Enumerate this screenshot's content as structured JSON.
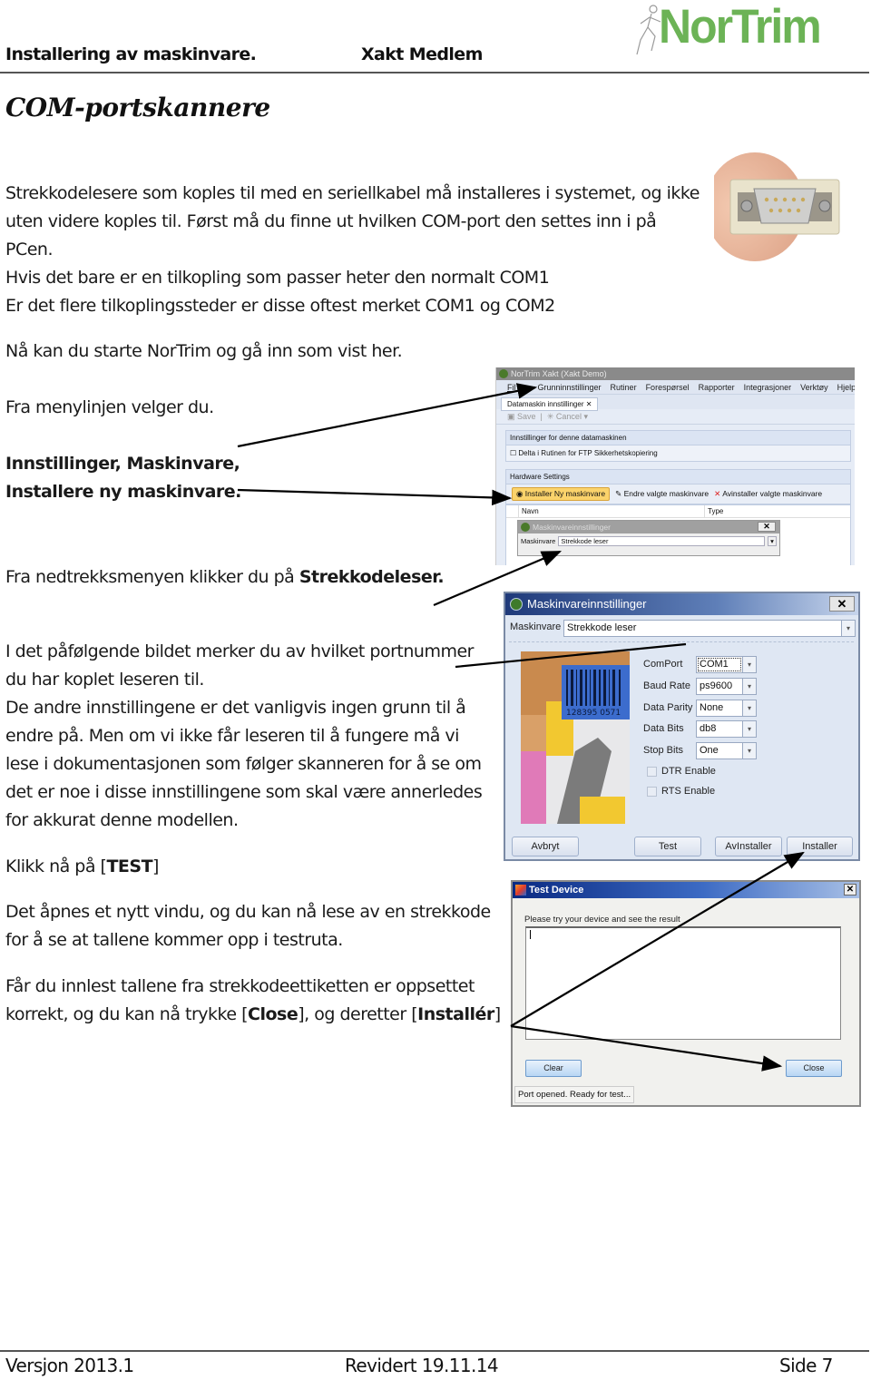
{
  "header": {
    "left_title": "Installering av maskinvare.",
    "center_title": "Xakt Medlem",
    "logo_text": "NorTrim"
  },
  "section_title": "COM-portskannere",
  "body": {
    "intro_lines": [
      "Strekkodelesere som koples til med en seriellkabel må installeres i systemet, og ikke",
      "uten videre koples til. Først må du finne ut hvilken COM-port den settes inn i på",
      "PCen.",
      "Hvis det bare er en tilkopling som passer heter den normalt COM1",
      "Er det flere tilkoplingssteder er disse oftest merket COM1 og COM2"
    ],
    "start_text": "Nå kan du starte NorTrim og gå inn som vist her.",
    "menu_text": "Fra menylinjen velger du.",
    "path_line1": "Innstillinger, Maskinvare,",
    "path_line2": "Installere ny maskinvare.",
    "dropdown_text_prefix": "Fra nedtrekksmenyen klikker du på ",
    "dropdown_text_bold": "Strekkodeleser.",
    "port_lines": [
      "I det påfølgende bildet merker du av hvilket portnummer",
      "du har koplet leseren til.",
      "De andre innstillingene er det vanligvis ingen grunn til å",
      "endre på. Men om vi ikke får leseren til å fungere må vi",
      "lese i dokumentasjonen som følger skanneren for å se om",
      "det er noe i disse innstillingene som skal være annerledes",
      "for akkurat denne modellen."
    ],
    "click_test_prefix": "Klikk nå på [",
    "click_test_bold": "TEST",
    "click_test_suffix": "]",
    "new_window_lines": [
      "Det åpnes et nytt vindu, og du kan nå lese av en strekkode",
      "for å se at tallene kommer opp i testruta."
    ],
    "final_line1": "Får du innlest tallene fra strekkodeettiketten er oppsettet",
    "final_line2_a": "korrekt, og du kan nå trykke [",
    "final_line2_close": "Close",
    "final_line2_b": "], og deretter [",
    "final_line2_install": "Installér",
    "final_line2_c": "]"
  },
  "screenshot_app": {
    "window_title": "NorTrim Xakt (Xakt Demo)",
    "menu": [
      "Fil",
      "Grunninnstillinger",
      "Rutiner",
      "Forespørsel",
      "Rapporter",
      "Integrasjoner",
      "Verktøy",
      "Hjelp"
    ],
    "tab": "Datamaskin innstillinger",
    "toolbar": [
      "Save",
      "Cancel"
    ],
    "group1_title": "Innstillinger for denne datamaskinen",
    "group1_checkbox": "Delta i Rutinen for FTP Sikkerhetskopiering",
    "group2_title": "Hardware Settings",
    "hw_buttons": [
      "Installer Ny maskinvare",
      "Endre valgte maskinvare",
      "Avinstaller valgte maskinvare"
    ],
    "grid_columns": [
      "Navn",
      "Type"
    ],
    "popup_title": "Maskinvareinnstillinger",
    "popup_label": "Maskinvare",
    "popup_value": "Strekkode leser"
  },
  "settings_dialog": {
    "title": "Maskinvareinnstillinger",
    "hardware_label": "Maskinvare",
    "hardware_value": "Strekkode leser",
    "fields": [
      {
        "label": "ComPort",
        "value": "COM1"
      },
      {
        "label": "Baud Rate",
        "value": "ps9600"
      },
      {
        "label": "Data Parity",
        "value": "None"
      },
      {
        "label": "Data Bits",
        "value": "db8"
      },
      {
        "label": "Stop Bits",
        "value": "One"
      }
    ],
    "checkboxes": [
      {
        "label": "DTR Enable",
        "checked": false
      },
      {
        "label": "RTS Enable",
        "checked": false
      }
    ],
    "buttons": {
      "cancel": "Avbryt",
      "test": "Test",
      "uninstall": "AvInstaller",
      "install": "Installer"
    },
    "barcode_number": "128395 0571"
  },
  "test_dialog": {
    "title": "Test Device",
    "prompt": "Please try your device and see the result",
    "result_value": "",
    "clear_label": "Clear",
    "close_label": "Close",
    "status": "Port opened. Ready for test..."
  },
  "footer": {
    "version": "Versjon 2013.1",
    "revised": "Revidert 19.11.14",
    "page": "Side 7"
  },
  "colors": {
    "logo_green": "#6cb356",
    "dialog_title_blue": "#1f3a7a",
    "highlight_button": "#fbd36b"
  }
}
